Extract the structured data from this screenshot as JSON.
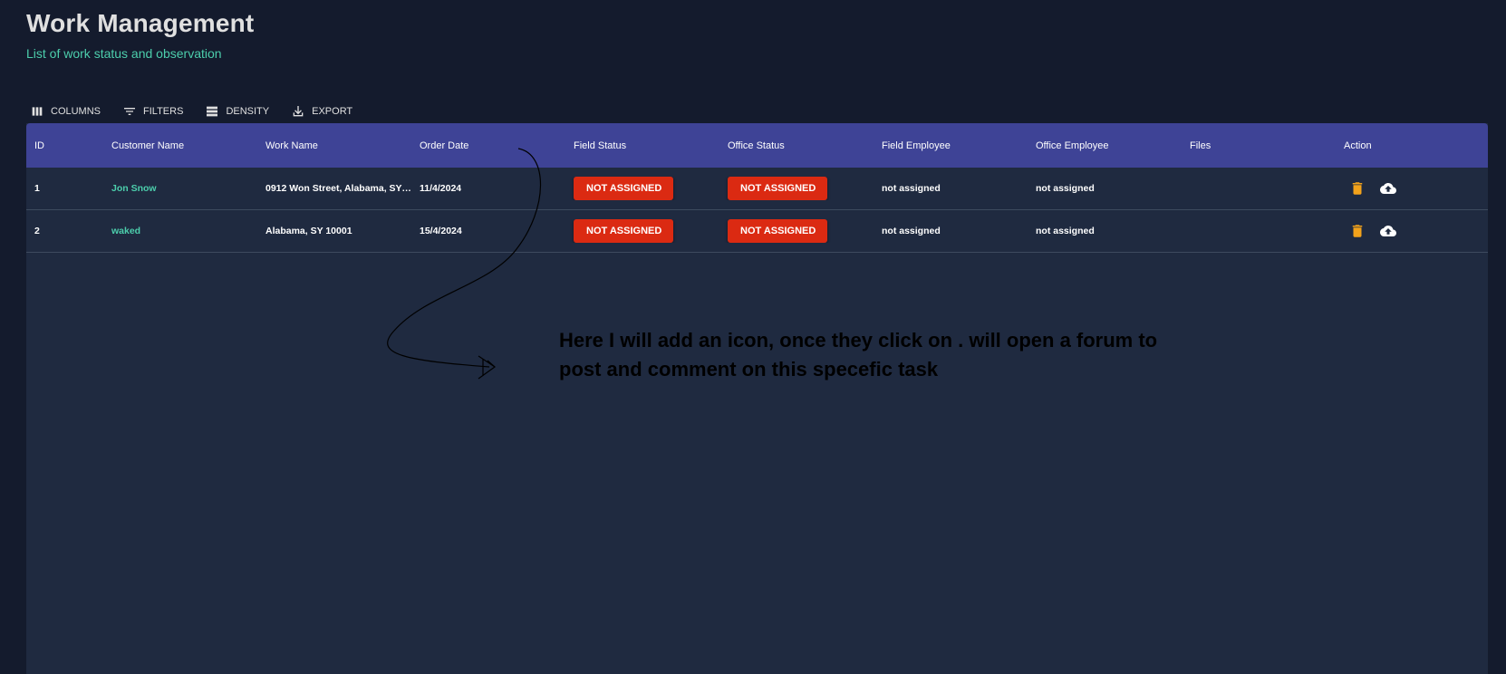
{
  "header": {
    "title": "Work Management",
    "subtitle": "List of work status and observation"
  },
  "toolbar": {
    "columns": "COLUMNS",
    "filters": "FILTERS",
    "density": "DENSITY",
    "export": "EXPORT"
  },
  "table": {
    "headers": {
      "id": "ID",
      "customer": "Customer Name",
      "work": "Work Name",
      "date": "Order Date",
      "field_status": "Field Status",
      "office_status": "Office Status",
      "field_employee": "Field Employee",
      "office_employee": "Office Employee",
      "files": "Files",
      "action": "Action"
    },
    "rows": [
      {
        "id": "1",
        "customer": "Jon Snow",
        "work": "0912 Won Street, Alabama, SY 1…",
        "date": "11/4/2024",
        "field_status": "NOT ASSIGNED",
        "office_status": "NOT ASSIGNED",
        "field_employee": "not assigned",
        "office_employee": "not assigned",
        "files": ""
      },
      {
        "id": "2",
        "customer": "waked",
        "work": "Alabama, SY 10001",
        "date": "15/4/2024",
        "field_status": "NOT ASSIGNED",
        "office_status": "NOT ASSIGNED",
        "field_employee": "not assigned",
        "office_employee": "not assigned",
        "files": ""
      }
    ]
  },
  "annotation": {
    "line1": "Here I will add an icon, once they click on . will open a forum to",
    "line2": "post and comment on this specefic  task"
  },
  "colors": {
    "background": "#141b2d",
    "grid": "#1f2a40",
    "header": "#3e4396",
    "accent": "#4cceac",
    "badge": "#db2a12",
    "delete_icon": "#f2a21b"
  },
  "icons": {
    "columns": "columns-icon",
    "filters": "filter-icon",
    "density": "density-icon",
    "export": "download-icon",
    "delete": "trash-icon",
    "upload": "cloud-upload-icon"
  }
}
